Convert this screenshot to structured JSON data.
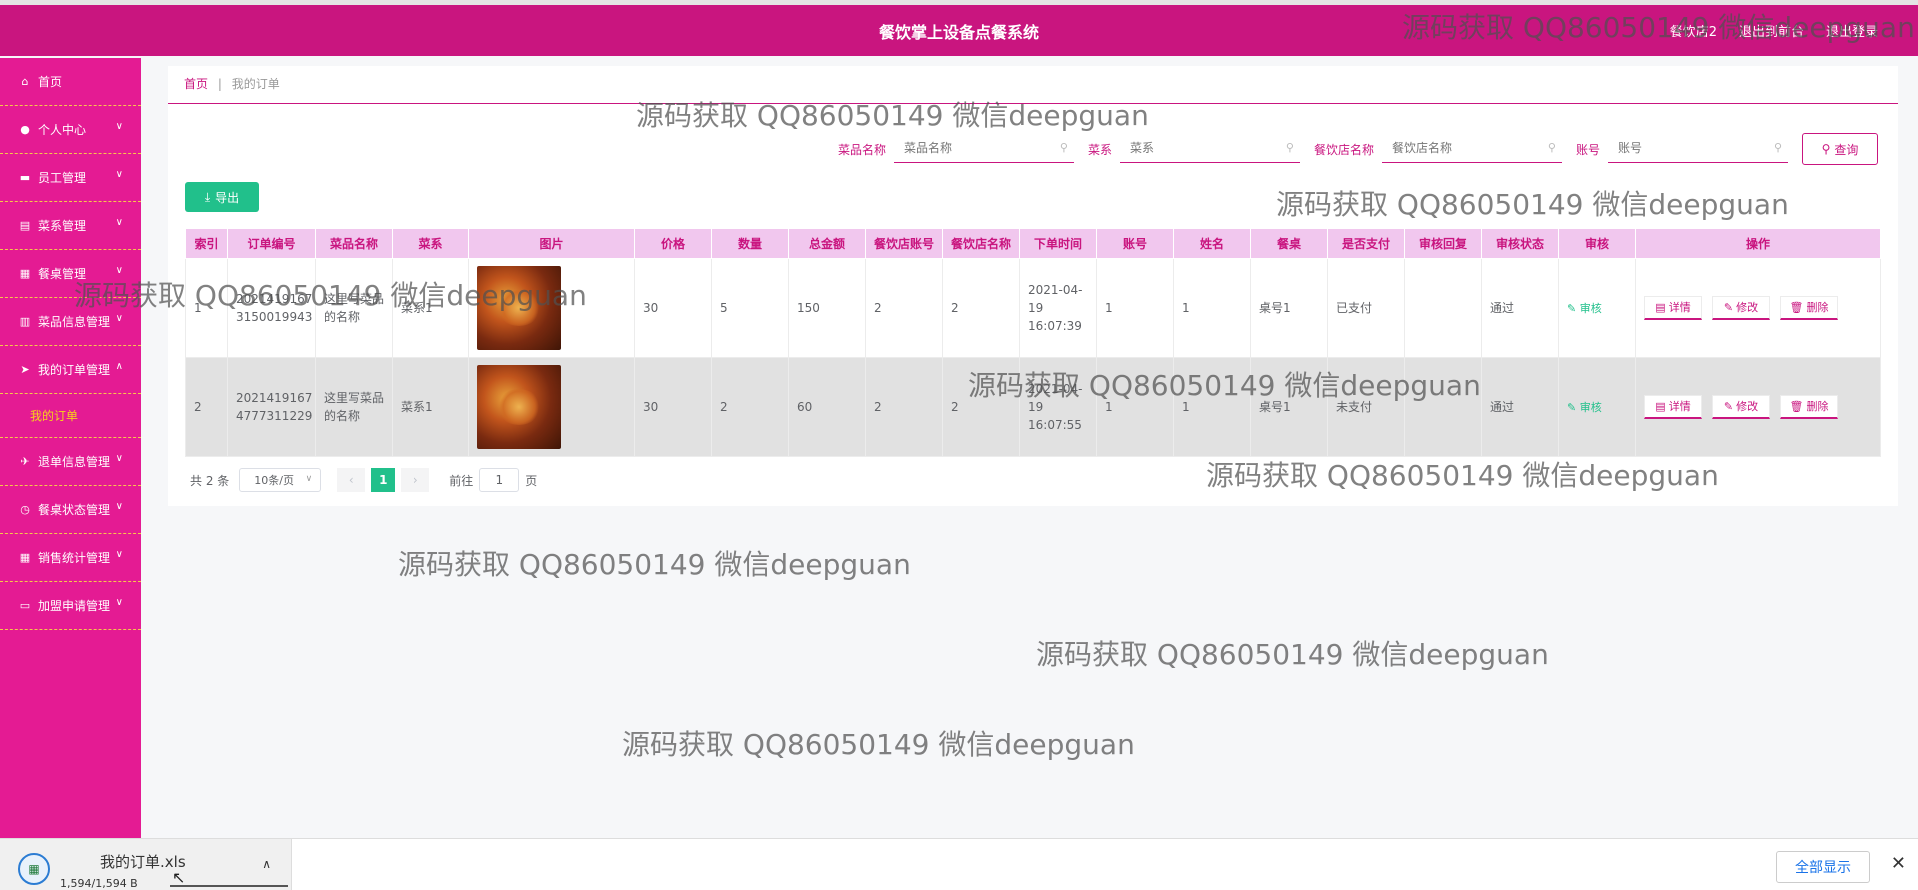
{
  "header": {
    "title": "餐饮掌上设备点餐系统",
    "user": "餐饮店2",
    "back_link": "退出到前台",
    "logout_link": "退出登录"
  },
  "sidebar": {
    "items": [
      {
        "label": "首页",
        "icon": "home-icon",
        "chevron": false
      },
      {
        "label": "个人中心",
        "icon": "user-icon",
        "chevron": true
      },
      {
        "label": "员工管理",
        "icon": "chat-icon",
        "chevron": true
      },
      {
        "label": "菜系管理",
        "icon": "box-icon",
        "chevron": true
      },
      {
        "label": "餐桌管理",
        "icon": "doc-icon",
        "chevron": true
      },
      {
        "label": "菜品信息管理",
        "icon": "store-icon",
        "chevron": true
      },
      {
        "label": "我的订单管理",
        "icon": "send-icon",
        "chevron": true,
        "expanded": true
      },
      {
        "label": "我的订单",
        "sub": true
      },
      {
        "label": "退单信息管理",
        "icon": "plane-icon",
        "chevron": true
      },
      {
        "label": "餐桌状态管理",
        "icon": "clock-icon",
        "chevron": true
      },
      {
        "label": "销售统计管理",
        "icon": "grid-icon",
        "chevron": true
      },
      {
        "label": "加盟申请管理",
        "icon": "ticket-icon",
        "chevron": true
      }
    ]
  },
  "breadcrumb": {
    "home": "首页",
    "separator": "|",
    "current": "我的订单"
  },
  "search": {
    "fields": [
      {
        "label": "菜品名称",
        "placeholder": "菜品名称"
      },
      {
        "label": "菜系",
        "placeholder": "菜系"
      },
      {
        "label": "餐饮店名称",
        "placeholder": "餐饮店名称"
      },
      {
        "label": "账号",
        "placeholder": "账号"
      }
    ],
    "button": "查询"
  },
  "export_button": "导出",
  "table": {
    "headers": [
      "索引",
      "订单编号",
      "菜品名称",
      "菜系",
      "图片",
      "价格",
      "数量",
      "总金额",
      "餐饮店账号",
      "餐饮店名称",
      "下单时间",
      "账号",
      "姓名",
      "餐桌",
      "是否支付",
      "审核回复",
      "审核状态",
      "审核",
      "操作"
    ],
    "rows": [
      {
        "index": "1",
        "order_no": "20214191673150019943",
        "dish": "这里写菜品的名称",
        "cuisine": "菜系1",
        "price": "30",
        "qty": "5",
        "total": "150",
        "shop_account": "2",
        "shop_name": "2",
        "time": "2021-04-19 16:07:39",
        "account": "1",
        "name": "1",
        "table": "桌号1",
        "paid": "已支付",
        "reply": "",
        "status": "通过",
        "audit": "审核"
      },
      {
        "index": "2",
        "order_no": "20214191674777311229",
        "dish": "这里写菜品的名称",
        "cuisine": "菜系1",
        "price": "30",
        "qty": "2",
        "total": "60",
        "shop_account": "2",
        "shop_name": "2",
        "time": "2021-04-19 16:07:55",
        "account": "1",
        "name": "1",
        "table": "桌号1",
        "paid": "未支付",
        "reply": "",
        "status": "通过",
        "audit": "审核"
      }
    ],
    "ops": {
      "detail": "详情",
      "edit": "修改",
      "delete": "删除"
    }
  },
  "pager": {
    "total": "共 2 条",
    "page_size": "10条/页",
    "current": "1",
    "goto_prefix": "前往",
    "goto_value": "1",
    "goto_suffix": "页"
  },
  "watermark": "源码获取 QQ86050149 微信deepguan",
  "download": {
    "file_name": "我的订单.xls",
    "file_size": "1,594/1,594 B",
    "show_all": "全部显示"
  },
  "colors": {
    "primary": "#c9157f",
    "sidebar": "#e41b93",
    "success": "#21c08b",
    "highlight": "#f6d31a"
  }
}
